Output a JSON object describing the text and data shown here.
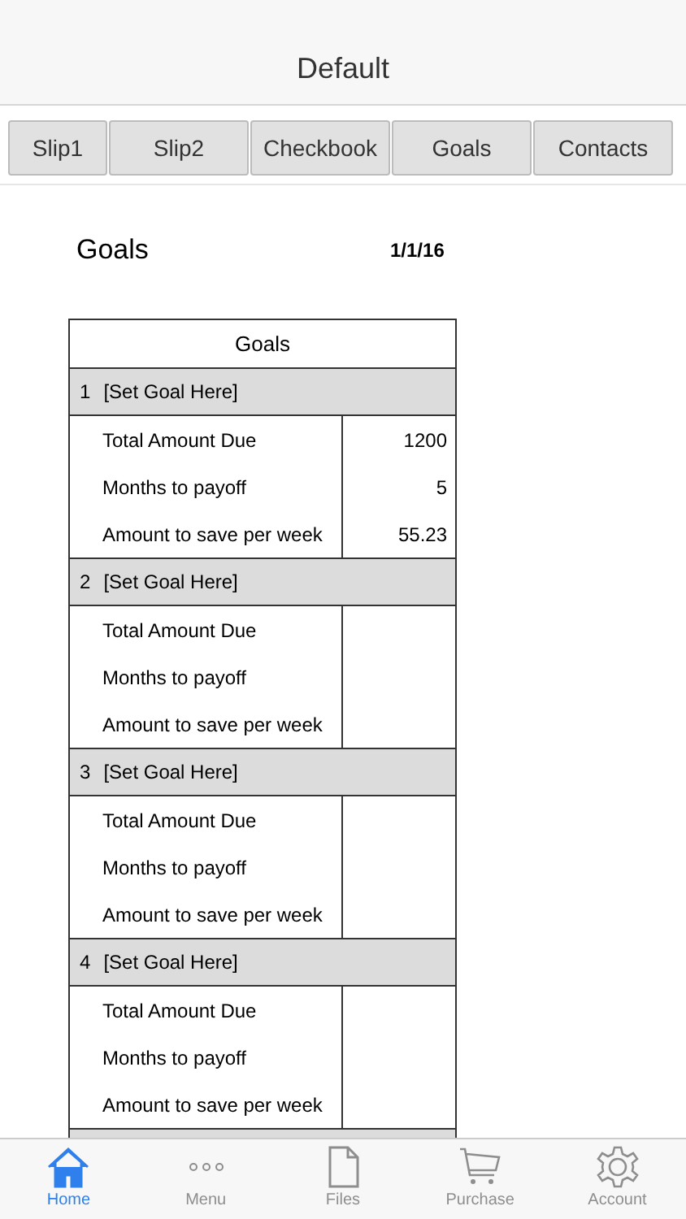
{
  "window": {
    "title": "Default"
  },
  "tabs": [
    {
      "label": "Slip1",
      "selected": false
    },
    {
      "label": "Slip2",
      "selected": false
    },
    {
      "label": "Checkbook",
      "selected": false
    },
    {
      "label": "Goals",
      "selected": false
    },
    {
      "label": "Contacts",
      "selected": false
    }
  ],
  "page": {
    "heading": "Goals",
    "date": "1/1/16"
  },
  "table": {
    "title": "Goals",
    "goals": [
      {
        "number": "1",
        "name": "[Set Goal Here]",
        "rows": [
          {
            "label": "Total Amount Due",
            "value": "1200"
          },
          {
            "label": "Months to payoff",
            "value": "5"
          },
          {
            "label": "Amount to save per week",
            "value": "55.23"
          }
        ]
      },
      {
        "number": "2",
        "name": "[Set Goal Here]",
        "rows": [
          {
            "label": "Total Amount Due",
            "value": ""
          },
          {
            "label": "Months to payoff",
            "value": ""
          },
          {
            "label": "Amount to save per week",
            "value": ""
          }
        ]
      },
      {
        "number": "3",
        "name": "[Set Goal Here]",
        "rows": [
          {
            "label": "Total Amount Due",
            "value": ""
          },
          {
            "label": "Months to payoff",
            "value": ""
          },
          {
            "label": "Amount to save per week",
            "value": ""
          }
        ]
      },
      {
        "number": "4",
        "name": "[Set Goal Here]",
        "rows": [
          {
            "label": "Total Amount Due",
            "value": ""
          },
          {
            "label": "Months to payoff",
            "value": ""
          },
          {
            "label": "Amount to save per week",
            "value": ""
          }
        ]
      }
    ]
  },
  "bottom_nav": [
    {
      "label": "Home",
      "kind": "home",
      "selected": true
    },
    {
      "label": "Menu",
      "kind": "menu",
      "selected": false
    },
    {
      "label": "Files",
      "kind": "files",
      "selected": false
    },
    {
      "label": "Purchase",
      "kind": "cart",
      "selected": false
    },
    {
      "label": "Account",
      "kind": "gear",
      "selected": false
    }
  ]
}
